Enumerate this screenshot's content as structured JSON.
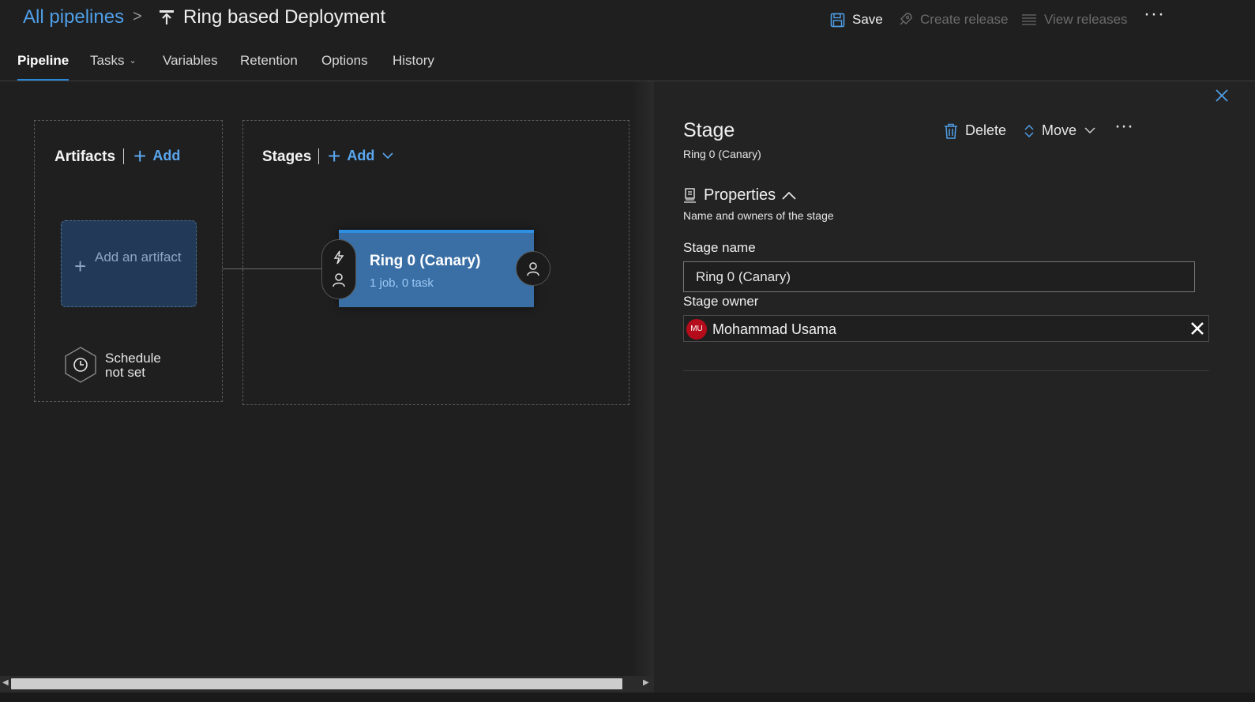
{
  "breadcrumb": {
    "root": "All pipelines",
    "separator": ">",
    "title": "Ring based Deployment"
  },
  "toolbar": {
    "save": "Save",
    "create_release": "Create release",
    "view_releases": "View releases",
    "more": "···"
  },
  "tabs": [
    {
      "label": "Pipeline"
    },
    {
      "label": "Tasks"
    },
    {
      "label": "Variables"
    },
    {
      "label": "Retention"
    },
    {
      "label": "Options"
    },
    {
      "label": "History"
    }
  ],
  "canvas": {
    "artifacts": {
      "title": "Artifacts",
      "add": "Add",
      "card_label": "Add an artifact",
      "schedule": "Schedule not set"
    },
    "stages": {
      "title": "Stages",
      "add": "Add"
    },
    "stage_card": {
      "name": "Ring 0 (Canary)",
      "summary": "1 job, 0 task"
    }
  },
  "panel": {
    "title": "Stage",
    "subtitle": "Ring 0 (Canary)",
    "delete": "Delete",
    "move": "Move",
    "more": "···",
    "properties": {
      "heading": "Properties",
      "description": "Name and owners of the stage",
      "stage_name_label": "Stage name",
      "stage_name_value": "Ring 0 (Canary)",
      "stage_owner_label": "Stage owner",
      "owner_initials": "MU",
      "owner_name": "Mohammad Usama"
    }
  },
  "colors": {
    "accent": "#2b88d8",
    "link": "#4f9fe8",
    "stage_card": "#3a6fa6",
    "avatar": "#b40c1b"
  }
}
